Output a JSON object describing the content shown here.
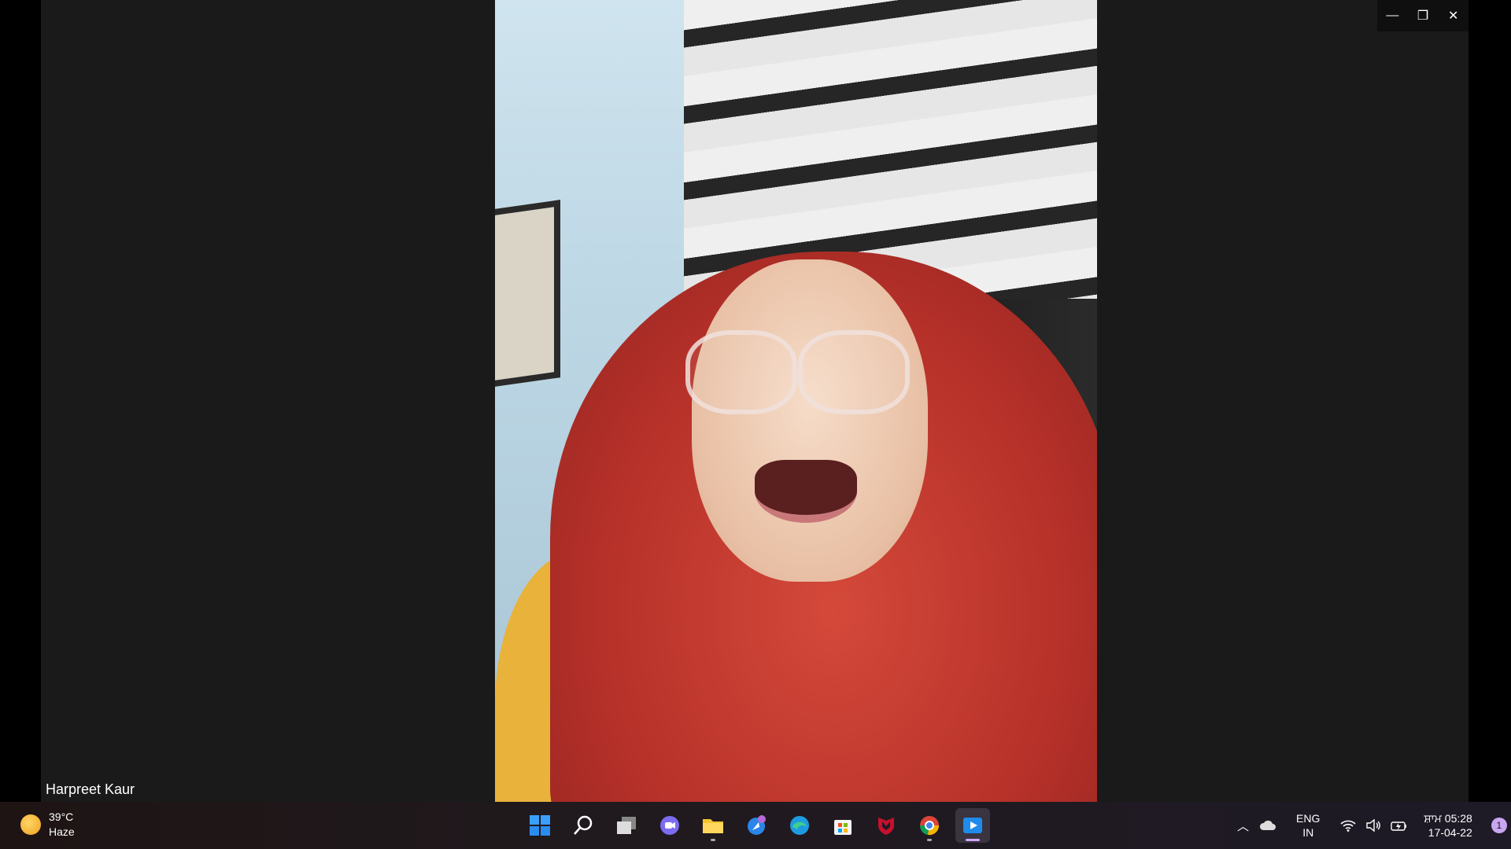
{
  "participant": {
    "name": "Harpreet Kaur"
  },
  "window_controls": {
    "minimize": "—",
    "restore": "❐",
    "close": "✕"
  },
  "taskbar": {
    "weather": {
      "temp": "39°C",
      "condition": "Haze",
      "icon": "sun-icon"
    },
    "apps": [
      {
        "name": "start-button",
        "icon": "windows-logo"
      },
      {
        "name": "search-button",
        "icon": "search-icon"
      },
      {
        "name": "task-view-button",
        "icon": "task-view-icon"
      },
      {
        "name": "chat-button",
        "icon": "chat-icon"
      },
      {
        "name": "file-explorer-button",
        "icon": "folder-icon"
      },
      {
        "name": "app-button",
        "icon": "app-icon"
      },
      {
        "name": "edge-button",
        "icon": "edge-icon"
      },
      {
        "name": "store-button",
        "icon": "store-icon"
      },
      {
        "name": "mcafee-button",
        "icon": "shield-icon"
      },
      {
        "name": "chrome-button",
        "icon": "chrome-icon"
      },
      {
        "name": "media-player-button",
        "icon": "play-icon"
      }
    ],
    "tray": {
      "lang_top": "ENG",
      "lang_bottom": "IN",
      "time": "ਸ਼ਾਮ 05:28",
      "date": "17-04-22",
      "notification_count": "1"
    }
  },
  "colors": {
    "stage": "#1a1a1a",
    "accent": "#c9a6f0"
  }
}
